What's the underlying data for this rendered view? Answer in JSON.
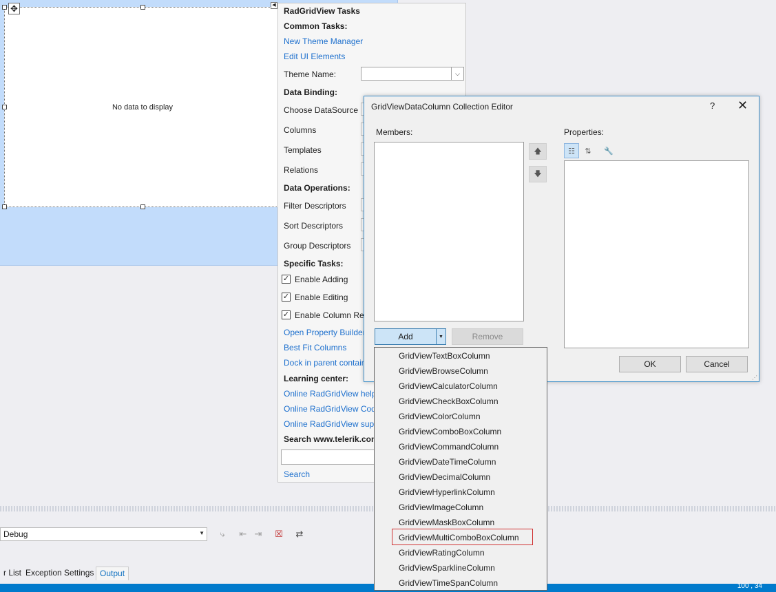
{
  "designer": {
    "no_data_text": "No data to display",
    "move_handle_glyph": "✥",
    "smarttag_glyph": "◀"
  },
  "tasks_panel": {
    "title": "RadGridView Tasks",
    "common_tasks_header": "Common Tasks:",
    "new_theme_manager": "New Theme Manager",
    "edit_ui_elements": "Edit UI Elements",
    "theme_name_label": "Theme Name:",
    "theme_name_value": "",
    "data_binding_header": "Data Binding:",
    "choose_datasource": "Choose DataSource",
    "columns": "Columns",
    "templates": "Templates",
    "relations": "Relations",
    "data_operations_header": "Data Operations:",
    "filter_descriptors": "Filter Descriptors",
    "sort_descriptors": "Sort Descriptors",
    "group_descriptors": "Group Descriptors",
    "specific_tasks_header": "Specific Tasks:",
    "enable_adding": "Enable Adding",
    "enable_editing": "Enable Editing",
    "enable_column_reorder": "Enable Column Rec",
    "open_property_builder": "Open Property Builder",
    "best_fit_columns": "Best Fit Columns",
    "dock_in_parent": "Dock in parent contain",
    "learning_center_header": "Learning center:",
    "online_help": "Online RadGridView help",
    "online_code": "Online RadGridView Code",
    "online_support": "Online RadGridView supp",
    "search_header": "Search www.telerik.com",
    "search_value": "",
    "search_link": "Search",
    "checkbox_glyph": "✓"
  },
  "dialog": {
    "title": "GridViewDataColumn Collection Editor",
    "help_glyph": "?",
    "close_glyph": "✕",
    "members_label": "Members:",
    "properties_label": "Properties:",
    "move_up_glyph": "🡅",
    "move_down_glyph": "🡇",
    "add_label": "Add",
    "add_split_glyph": "▼",
    "remove_label": "Remove",
    "ok_label": "OK",
    "cancel_label": "Cancel",
    "categorized_glyph": "☷",
    "alphabetical_glyph": "⇅",
    "property_pages_glyph": "🔧",
    "grip_glyph": "⋰"
  },
  "add_dropdown": {
    "items": [
      "GridViewTextBoxColumn",
      "GridViewBrowseColumn",
      "GridViewCalculatorColumn",
      "GridViewCheckBoxColumn",
      "GridViewColorColumn",
      "GridViewComboBoxColumn",
      "GridViewCommandColumn",
      "GridViewDateTimeColumn",
      "GridViewDecimalColumn",
      "GridViewHyperlinkColumn",
      "GridViewImageColumn",
      "GridViewMaskBoxColumn",
      "GridViewMultiComboBoxColumn",
      "GridViewRatingColumn",
      "GridViewSparklineColumn",
      "GridViewTimeSpanColumn"
    ],
    "highlighted": "GridViewMultiComboBoxColumn"
  },
  "bottom": {
    "config_value": "Debug",
    "config_arrow": "▼",
    "tab_error_list": "r List",
    "tab_exception_settings": "Exception Settings",
    "tab_output": "Output",
    "status_text": "100 , 34"
  },
  "colors": {
    "accent": "#007acc",
    "link": "#1c6fcd",
    "highlight_border": "#d03030",
    "design_surface": "#c2dcfb"
  }
}
